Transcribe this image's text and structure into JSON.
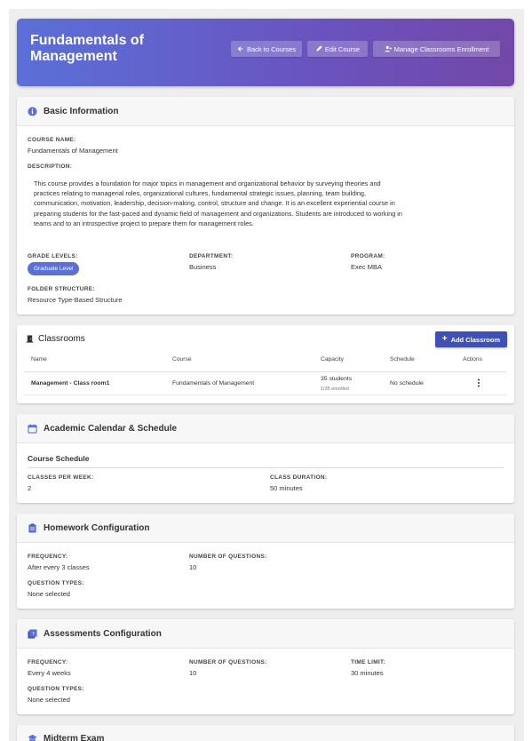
{
  "header": {
    "title": "Fundamentals of Management",
    "buttons": {
      "back": "Back to Courses",
      "edit": "Edit Course",
      "manage": "Manage Classrooms Enrollment"
    }
  },
  "basic_info": {
    "title": "Basic Information",
    "course_name_label": "COURSE NAME:",
    "course_name": "Fundamentals of Management",
    "description_label": "DESCRIPTION:",
    "description": "This course provides a foundation for major topics in management and organizational behavior by surveying theories and practices relating to managerial roles, organizational cultures, fundamental strategic issues, planning, team building, communication, motivation, leadership, decision-making, control, structure and change. It is an excellent experiential course in preparing students for the fast-paced and dynamic field of management and organizations. Students are introduced to working in teams and to an introspective project to prepare them for management roles.",
    "grade_levels_label": "GRADE LEVELS:",
    "grade_level": "Graduate Level",
    "department_label": "DEPARTMENT:",
    "department": "Business",
    "program_label": "PROGRAM:",
    "program": "Exec MBA",
    "folder_label": "FOLDER STRUCTURE:",
    "folder": "Resource Type-Based Structure"
  },
  "classrooms": {
    "title": "Classrooms",
    "add_button": "Add Classroom",
    "columns": [
      "Name",
      "Course",
      "Capacity",
      "Schedule",
      "Actions"
    ],
    "rows": [
      {
        "name": "Management - Class room1",
        "course": "Fundamentals of Management",
        "capacity": "35 students",
        "enrolled": "1/35 enrolled",
        "schedule": "No schedule"
      }
    ]
  },
  "calendar": {
    "title": "Academic Calendar & Schedule",
    "subtitle": "Course Schedule",
    "classes_per_week_label": "CLASSES PER WEEK:",
    "classes_per_week": "2",
    "class_duration_label": "CLASS DURATION:",
    "class_duration": "50 minutes"
  },
  "homework": {
    "title": "Homework Configuration",
    "frequency_label": "FREQUENCY:",
    "frequency": "After every 3 classes",
    "questions_label": "NUMBER OF QUESTIONS:",
    "questions": "10",
    "types_label": "QUESTION TYPES:",
    "types": "None selected"
  },
  "assessments": {
    "title": "Assessments Configuration",
    "frequency_label": "FREQUENCY:",
    "frequency": "Every 4 weeks",
    "questions_label": "NUMBER OF QUESTIONS:",
    "questions": "10",
    "time_label": "TIME LIMIT:",
    "time": "30 minutes",
    "types_label": "QUESTION TYPES:",
    "types": "None selected"
  },
  "midterm": {
    "title": "Midterm Exam"
  },
  "colors": {
    "accent": "#3f51b5",
    "header_start": "#5b70d8",
    "header_end": "#7248a8",
    "badge": "#5b6fd8"
  }
}
